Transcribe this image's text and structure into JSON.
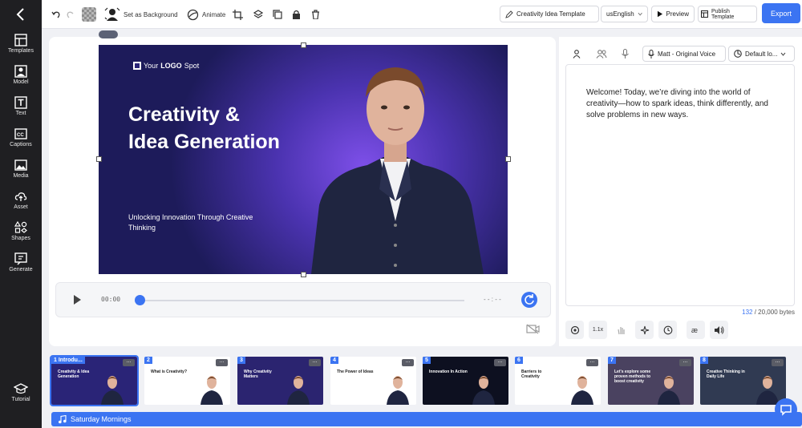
{
  "rail": {
    "items": [
      {
        "label": "Templates",
        "icon": "templates-icon"
      },
      {
        "label": "Model",
        "icon": "model-icon"
      },
      {
        "label": "Text",
        "icon": "text-icon"
      },
      {
        "label": "Captions",
        "icon": "captions-icon"
      },
      {
        "label": "Media",
        "icon": "media-icon"
      },
      {
        "label": "Asset",
        "icon": "asset-icon"
      },
      {
        "label": "Shapes",
        "icon": "shapes-icon"
      },
      {
        "label": "Generate",
        "icon": "generate-icon"
      }
    ],
    "tutorial": "Tutorial"
  },
  "toolbar": {
    "set_background": "Set as Background",
    "animate": "Animate",
    "template_name": "Creativity Idea Template",
    "language": "usEnglish",
    "preview": "Preview",
    "publish": "Publish Template",
    "export": "Export"
  },
  "slide": {
    "logo_prefix": "Your",
    "logo_bold": "LOGO",
    "logo_suffix": "Spot",
    "title_line1": "Creativity &",
    "title_line2": "Idea Generation",
    "subtitle": "Unlocking Innovation Through Creative Thinking"
  },
  "player": {
    "current_time": "00:00",
    "end_time": "- - : - -",
    "progress": 0
  },
  "right_panel": {
    "voice": "Matt - Original Voice",
    "style": "Default lo...",
    "script": "Welcome! Today, we’re diving into the world of creativity—how to spark ideas, think differently, and solve problems in new ways.",
    "bytes_used": "132",
    "bytes_total": " / 20,000 bytes",
    "speed": "1.1x"
  },
  "timeline": {
    "scenes": [
      {
        "num": "1",
        "title": "Introdu...",
        "slide_title": "Creativity & Idea Generation",
        "bg": "#2a2477"
      },
      {
        "num": "2",
        "title": "",
        "slide_title": "What is Creativity?",
        "bg": "#ffffff"
      },
      {
        "num": "3",
        "title": "",
        "slide_title": "Why Creativity Matters",
        "bg": "#2b2470"
      },
      {
        "num": "4",
        "title": "",
        "slide_title": "The Power of Ideas",
        "bg": "#ffffff"
      },
      {
        "num": "5",
        "title": "",
        "slide_title": "Innovation In Action",
        "bg": "#0d1020"
      },
      {
        "num": "6",
        "title": "",
        "slide_title": "Barriers to Creativity",
        "bg": "#ffffff"
      },
      {
        "num": "7",
        "title": "",
        "slide_title": "Let's explore some proven methods to boost creativity",
        "bg": "#4a4260"
      },
      {
        "num": "8",
        "title": "",
        "slide_title": "Creative Thinking in Daily Life",
        "bg": "#303a52"
      }
    ],
    "audio_track": "Saturday Mornings"
  }
}
